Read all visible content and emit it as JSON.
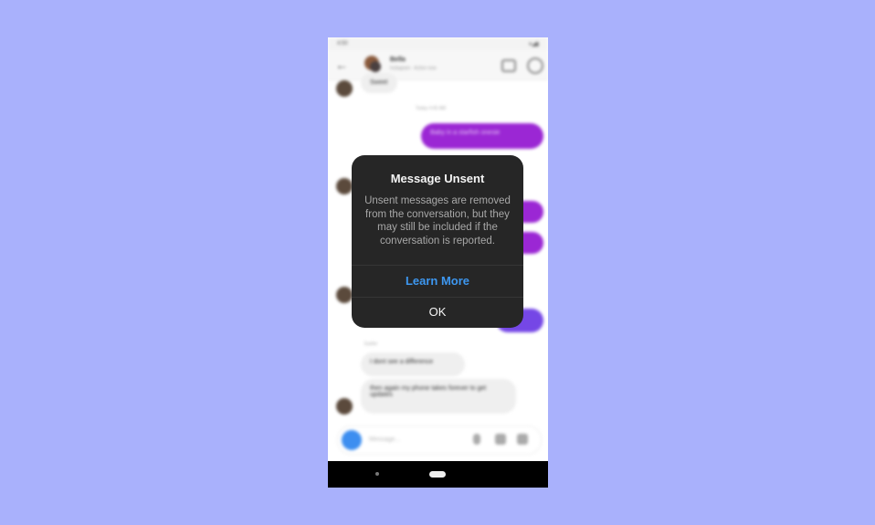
{
  "background_color": "#A9B1FC",
  "phone": {
    "status_bar": {
      "time": "4:50",
      "icons": "wifi signal battery"
    },
    "header": {
      "contact_name": "Bella",
      "contact_subtitle": "Instagram · Active now",
      "icons": [
        "back-arrow-icon",
        "video-call-icon",
        "info-icon"
      ]
    },
    "messages": [
      {
        "side": "in",
        "text": "Sweet"
      },
      {
        "type": "timestamp",
        "text": "Today 4:45 AM"
      },
      {
        "side": "out",
        "text": "Baby in a starfish onesie"
      },
      {
        "side": "out",
        "text": "..."
      },
      {
        "side": "out",
        "text": "..."
      },
      {
        "side": "out",
        "text": "..."
      },
      {
        "type": "timestamp",
        "text": "Earlier"
      },
      {
        "side": "in",
        "text": "I dont see a difference"
      },
      {
        "side": "in",
        "text": "then again my phone takes forever to get updates"
      }
    ],
    "composer": {
      "placeholder": "Message..."
    }
  },
  "dialog": {
    "title": "Message Unsent",
    "body": "Unsent messages are removed from the conversation, but they may still be included if the conversation is reported.",
    "learn_more_label": "Learn More",
    "ok_label": "OK",
    "accent_color": "#3D97F0"
  }
}
